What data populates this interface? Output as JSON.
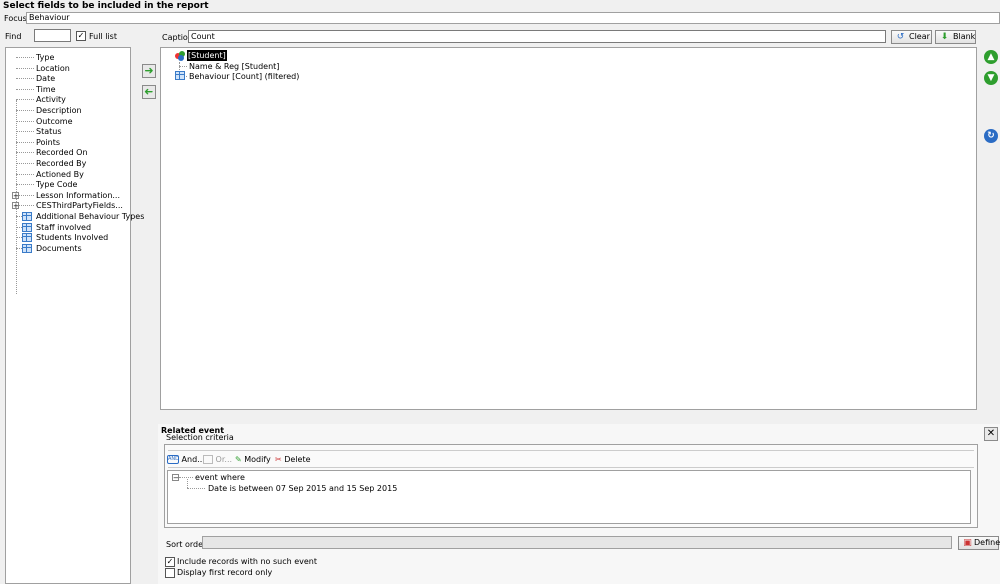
{
  "header": {
    "title": "Select fields to be included in the report",
    "focus_label": "Focus",
    "focus_value": "Behaviour"
  },
  "find": {
    "label": "Find",
    "value": "",
    "full_list_label": "Full list",
    "full_list_checked": true
  },
  "left_tree": {
    "items": [
      {
        "label": "Type",
        "kind": "leaf"
      },
      {
        "label": "Location",
        "kind": "leaf"
      },
      {
        "label": "Date",
        "kind": "leaf"
      },
      {
        "label": "Time",
        "kind": "leaf"
      },
      {
        "label": "Activity",
        "kind": "leaf"
      },
      {
        "label": "Description",
        "kind": "leaf"
      },
      {
        "label": "Outcome",
        "kind": "leaf"
      },
      {
        "label": "Status",
        "kind": "leaf"
      },
      {
        "label": "Points",
        "kind": "leaf"
      },
      {
        "label": "Recorded On",
        "kind": "leaf"
      },
      {
        "label": "Recorded By",
        "kind": "leaf"
      },
      {
        "label": "Actioned By",
        "kind": "leaf"
      },
      {
        "label": "Type Code",
        "kind": "leaf"
      },
      {
        "label": "Lesson Information...",
        "kind": "expandable"
      },
      {
        "label": "CESThirdPartyFields...",
        "kind": "expandable"
      },
      {
        "label": "Additional Behaviour Types",
        "kind": "table"
      },
      {
        "label": "Staff involved",
        "kind": "table"
      },
      {
        "label": "Students Involved",
        "kind": "table"
      },
      {
        "label": "Documents",
        "kind": "table"
      }
    ]
  },
  "caption": {
    "label": "Caption",
    "value": "Count",
    "clear_label": "Clear",
    "blank_label": "Blank"
  },
  "selected_fields": {
    "root": "[Student]",
    "children": [
      "Name & Reg [Student]",
      "Behaviour [Count] (filtered)"
    ]
  },
  "related_event": {
    "title": "Related event",
    "selection_criteria_label": "Selection criteria",
    "toolbar": {
      "and": "And...",
      "or": "Or...",
      "modify": "Modify",
      "delete": "Delete"
    },
    "criteria_root": "event where",
    "criteria_child": "Date is between 07 Sep 2015 and 15 Sep 2015"
  },
  "sort": {
    "label": "Sort order",
    "value": "",
    "define_label": "Define"
  },
  "options": {
    "include_no_event": "Include records with no such event",
    "include_no_event_checked": true,
    "first_record_only": "Display first record only",
    "first_record_only_checked": false
  },
  "colors": {
    "accent_green": "#2e9e2e",
    "accent_blue": "#2b6cc4",
    "panel_border": "#a0a0a0"
  }
}
